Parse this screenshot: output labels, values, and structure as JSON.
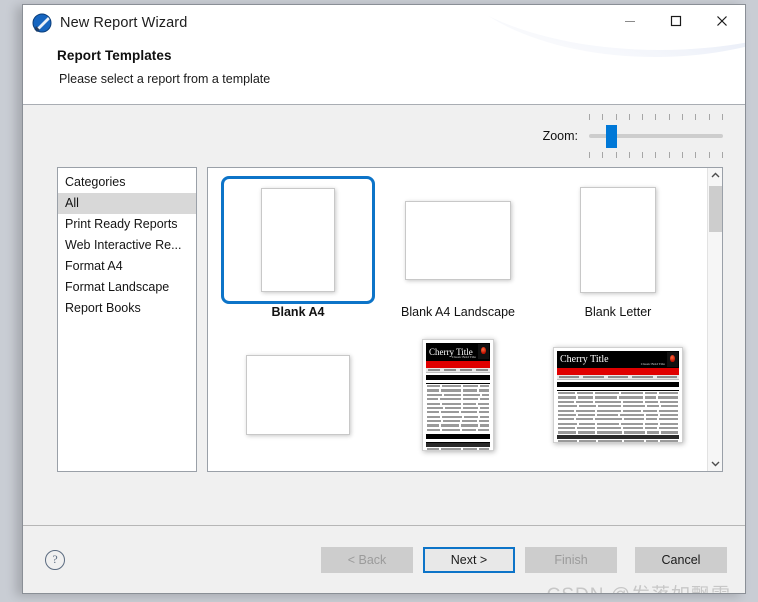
{
  "window": {
    "title": "New Report Wizard",
    "app_icon": "report-wizard-icon",
    "controls": {
      "minimize": "minimize-icon",
      "maximize": "maximize-icon",
      "close": "close-icon"
    }
  },
  "header": {
    "page_title": "Report Templates",
    "page_subtitle": "Please select a report from a template"
  },
  "zoom": {
    "label": "Zoom:",
    "value": 13,
    "min": 0,
    "max": 100,
    "ticks": 11
  },
  "categories": {
    "header": "Categories",
    "items": [
      {
        "label": "All",
        "selected": true
      },
      {
        "label": "Print Ready Reports",
        "selected": false
      },
      {
        "label": "Web Interactive Re...",
        "selected": false
      },
      {
        "label": "Format A4",
        "selected": false
      },
      {
        "label": "Format Landscape",
        "selected": false
      },
      {
        "label": "Report Books",
        "selected": false
      }
    ]
  },
  "gallery": {
    "templates": [
      {
        "label": "Blank A4",
        "kind": "paper-portrait",
        "selected": true
      },
      {
        "label": "Blank A4 Landscape",
        "kind": "paper-landscape",
        "selected": false
      },
      {
        "label": "Blank Letter",
        "kind": "paper-portrait",
        "selected": false
      },
      {
        "label": "",
        "kind": "paper-landscape",
        "selected": false
      },
      {
        "label": "",
        "kind": "report-portrait",
        "selected": false,
        "report_title": "Cherry Title",
        "report_subtitle": "Classic Bold Title"
      },
      {
        "label": "",
        "kind": "report-landscape",
        "selected": false,
        "report_title": "Cherry Title",
        "report_subtitle": "Classic Bold Title"
      }
    ],
    "scrollbar": {
      "up": "chevron-up-icon",
      "down": "chevron-down-icon"
    }
  },
  "footer": {
    "help": "?",
    "buttons": [
      {
        "label": "< Back",
        "state": "disabled"
      },
      {
        "label": "Next >",
        "state": "focused"
      },
      {
        "label": "Finish",
        "state": "disabled"
      },
      {
        "label": "Cancel",
        "state": "enabled"
      }
    ]
  },
  "watermark": "CSDN @发落如飘雪",
  "colors": {
    "accent": "#0d74c8",
    "slider_thumb": "#0078d7",
    "selection": "#d8d8d8",
    "report_band": "#e00000",
    "window_bg": "#f0f0f0"
  }
}
